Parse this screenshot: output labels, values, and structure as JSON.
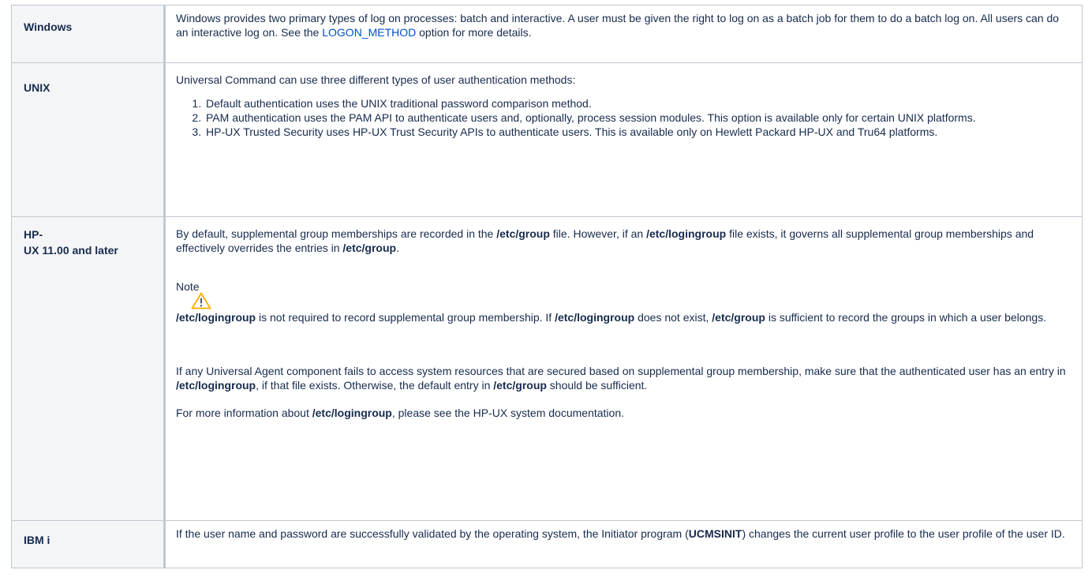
{
  "rows": {
    "windows": {
      "label": "Windows",
      "text_1": "Windows provides two primary types of log on processes: batch and interactive. A user must be given the right to log on as a batch job for them to do a batch log on. All users can do an interactive log on. See the ",
      "link": "LOGON_METHOD",
      "text_2": " option for more details."
    },
    "unix": {
      "label": "UNIX",
      "intro": "Universal Command can use three different types of user authentication methods:",
      "items": [
        "Default authentication uses the UNIX traditional password comparison method.",
        "PAM authentication uses the PAM API to authenticate users and, optionally, process session modules. This option is available only for certain UNIX platforms.",
        "HP-UX Trusted Security uses HP-UX Trust Security APIs to authenticate users. This is available only on Hewlett Packard HP-UX and Tru64 platforms."
      ]
    },
    "hpux": {
      "label_line1": "HP-",
      "label_line2": "UX 11.00 and later",
      "p1_a": "By default, supplemental group memberships are recorded in the ",
      "p1_b": "/etc/group",
      "p1_c": " file. However, if an ",
      "p1_d": "/etc/logingroup",
      "p1_e": " file exists, it governs all supplemental group memberships and effectively overrides the entries in ",
      "p1_f": "/etc/group",
      "p1_g": ".",
      "note_title": "Note",
      "note_icon": "warning-icon",
      "note_a": "/etc/logingroup",
      "note_b": " is not required to record supplemental group membership. If ",
      "note_c": "/etc/logingroup",
      "note_d": " does not exist, ",
      "note_e": "/etc/group",
      "note_f": " is sufficient to record the groups in which a user belongs.",
      "p2_a": "If any Universal Agent component fails to access system resources that are secured based on supplemental group membership, make sure that the authenticated user has an entry in ",
      "p2_b": "/etc/logingroup",
      "p2_c": ", if that file exists. Otherwise, the default entry in ",
      "p2_d": "/etc/group",
      "p2_e": " should be sufficient.",
      "p3_a": "For more information about ",
      "p3_b": "/etc/logingroup",
      "p3_c": ", please see the HP-UX system documentation."
    },
    "ibmi": {
      "label": "IBM i",
      "text_a": "If the user name and password are successfully validated by the operating system, the Initiator program (",
      "text_b": "UCMSINIT",
      "text_c": ") changes the current user profile to the user profile of the user ID."
    }
  },
  "colors": {
    "header_bg": "#f4f5f7",
    "border": "#c1c7d0",
    "link": "#0052cc",
    "text": "#172b4d",
    "warning": "#ffab00"
  }
}
